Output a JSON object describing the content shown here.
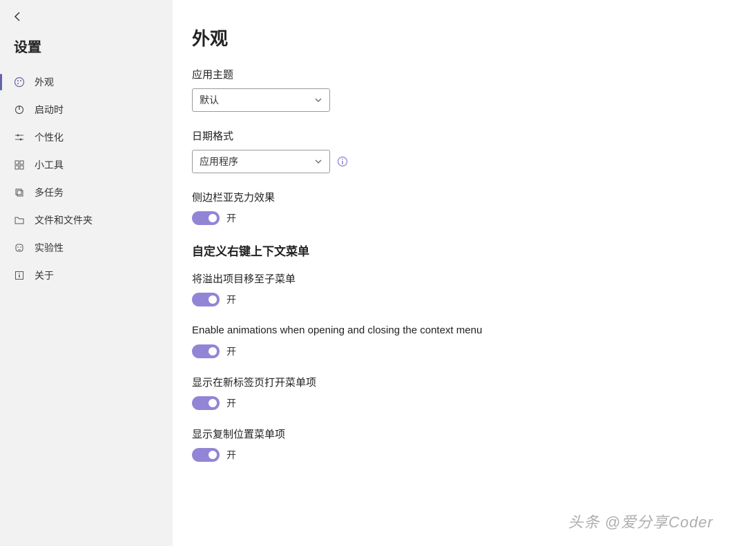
{
  "sidebar": {
    "title": "设置",
    "items": [
      {
        "label": "外观",
        "active": true
      },
      {
        "label": "启动时",
        "active": false
      },
      {
        "label": "个性化",
        "active": false
      },
      {
        "label": "小工具",
        "active": false
      },
      {
        "label": "多任务",
        "active": false
      },
      {
        "label": "文件和文件夹",
        "active": false
      },
      {
        "label": "实验性",
        "active": false
      },
      {
        "label": "关于",
        "active": false
      }
    ]
  },
  "main": {
    "title": "外观",
    "theme": {
      "label": "应用主题",
      "value": "默认"
    },
    "dateFormat": {
      "label": "日期格式",
      "value": "应用程序"
    },
    "acrylic": {
      "label": "侧边栏亚克力效果",
      "state": "开"
    },
    "contextMenu": {
      "title": "自定义右键上下文菜单",
      "overflow": {
        "label": "将溢出项目移至子菜单",
        "state": "开"
      },
      "animations": {
        "label": "Enable animations when opening and closing the context menu",
        "state": "开"
      },
      "newTab": {
        "label": "显示在新标签页打开菜单项",
        "state": "开"
      },
      "copyLocation": {
        "label": "显示复制位置菜单项",
        "state": "开"
      }
    }
  },
  "watermark": "头条 @爱分享Coder"
}
